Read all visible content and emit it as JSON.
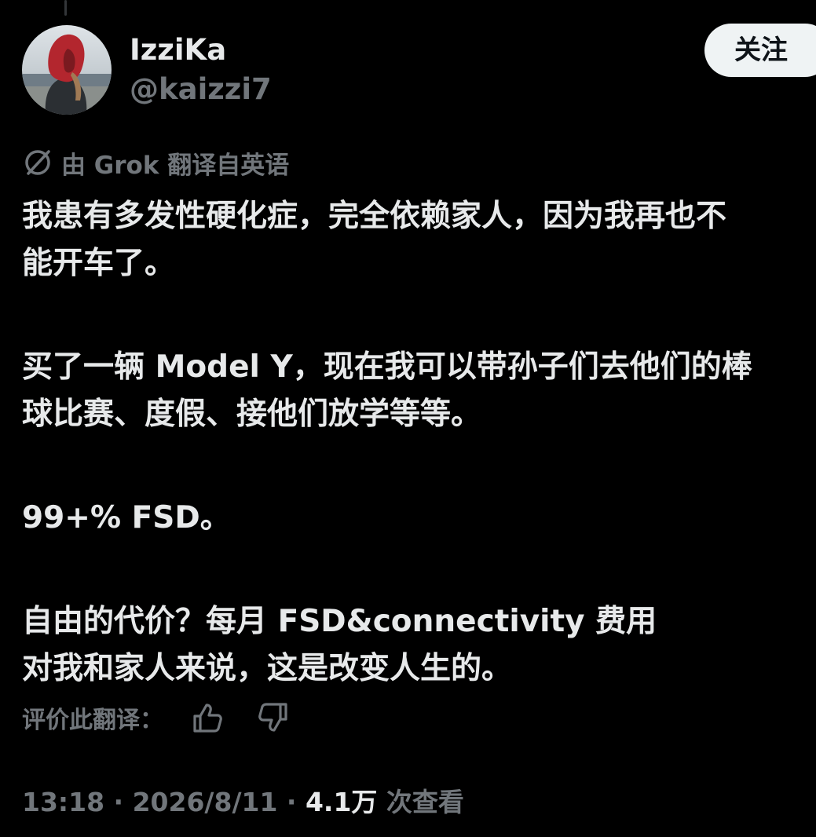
{
  "colors": {
    "background": "#000000",
    "primary_text": "#e7e9ea",
    "secondary_text": "#71767b",
    "follow_button_bg": "#eff3f4",
    "follow_button_text": "#0f1419"
  },
  "user": {
    "display_name": "IzziKa",
    "handle": "@kaizzi7",
    "avatar_icon": "avatar-red-hood"
  },
  "follow_button": {
    "label": "关注"
  },
  "translation": {
    "icon": "grok-icon",
    "text": "由 Grok 翻译自英语"
  },
  "tweet": {
    "paragraphs": [
      {
        "lines": [
          "我患有多发性硬化症，完全依赖家人，因为我再也不",
          "能开车了。"
        ]
      },
      {
        "lines": [
          "买了一辆 Model Y，现在我可以带孙子们去他们的棒",
          "球比赛、度假、接他们放学等等。"
        ]
      },
      {
        "lines": [
          "99+% FSD。"
        ]
      },
      {
        "lines": [
          "自由的代价？每月 FSD&connectivity 费用",
          "对我和家人来说，这是改变人生的。"
        ]
      }
    ]
  },
  "rating": {
    "label": "评价此翻译：",
    "thumbs_up_icon": "thumbs-up-icon",
    "thumbs_down_icon": "thumbs-down-icon"
  },
  "meta": {
    "time": "13:18",
    "date": "2026/8/11",
    "views_count": "4.1万",
    "views_label": "次查看"
  }
}
